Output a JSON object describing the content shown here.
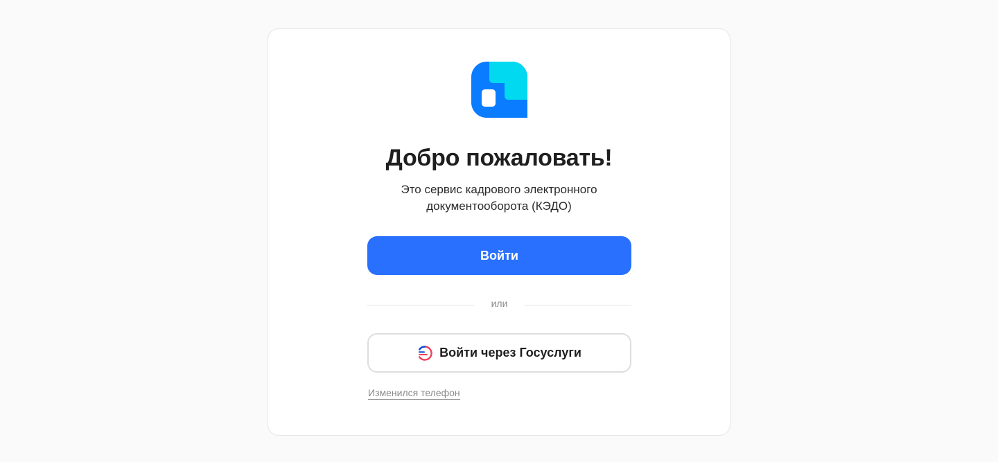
{
  "colors": {
    "background": "#fafafa",
    "card": "#ffffff",
    "primary": "#2970ff",
    "logo_blue": "#0a7cff",
    "logo_cyan": "#00d9f0",
    "muted": "#8a8a8a"
  },
  "logo": {
    "icon": "kedo-logo-icon"
  },
  "welcome": {
    "title": "Добро пожаловать!",
    "subtitle_line1": "Это сервис кадрового электронного",
    "subtitle_line2": "документооборота (КЭДО)"
  },
  "login_button": {
    "label": "Войти"
  },
  "divider": {
    "label": "или"
  },
  "gosuslugi_button": {
    "label": "Войти через Госуслуги",
    "icon": "gosuslugi-icon"
  },
  "phone_changed_link": {
    "label": "Изменился телефон"
  }
}
